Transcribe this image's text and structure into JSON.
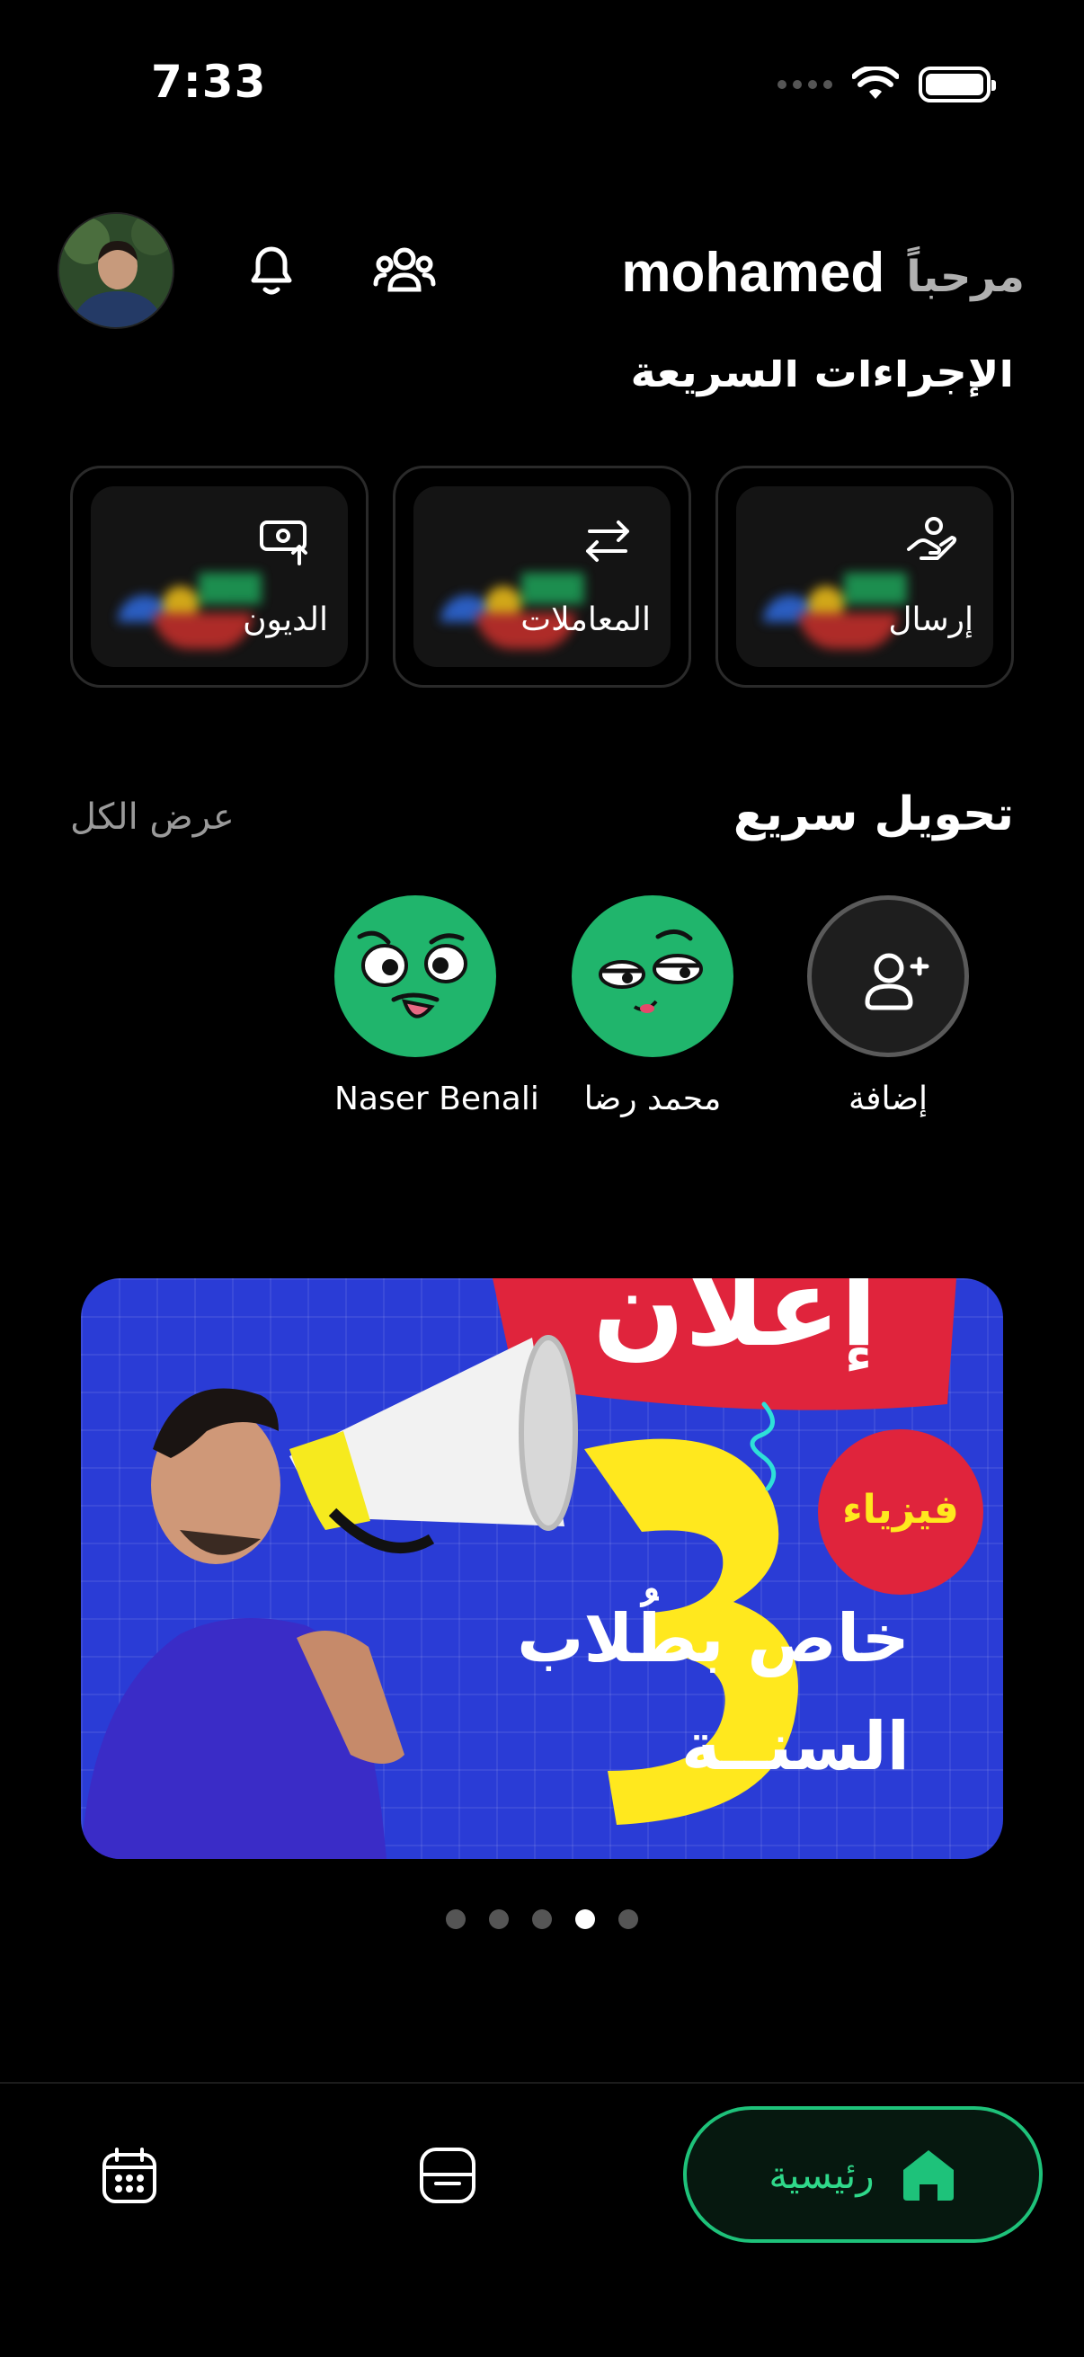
{
  "status_bar": {
    "time": "7:33"
  },
  "header": {
    "greeting": "مرحباً",
    "user_name": "mohamed"
  },
  "quick_actions": {
    "title": "الإجراءات السريعة",
    "items": [
      {
        "label": "إرسال",
        "icon": "hand-money-icon"
      },
      {
        "label": "المعاملات",
        "icon": "transfer-arrows-icon"
      },
      {
        "label": "الديون",
        "icon": "money-upload-icon"
      }
    ]
  },
  "quick_transfer": {
    "title": "تحويل سريع",
    "view_all": "عرض الكل",
    "contacts": [
      {
        "name": "إضافة",
        "icon": "add-user-icon"
      },
      {
        "name": "محمد رضا"
      },
      {
        "name": "Naser Benali"
      }
    ]
  },
  "banner": {
    "headline": "إعلان",
    "badge": "فيزياء",
    "number": "3",
    "line1": "خاص بطُلاب",
    "line2": "السنــة",
    "slides": 5,
    "active_slide": 4
  },
  "bottom_nav": {
    "home_label": "رئيسية",
    "accent_color": "#1ec27a"
  }
}
